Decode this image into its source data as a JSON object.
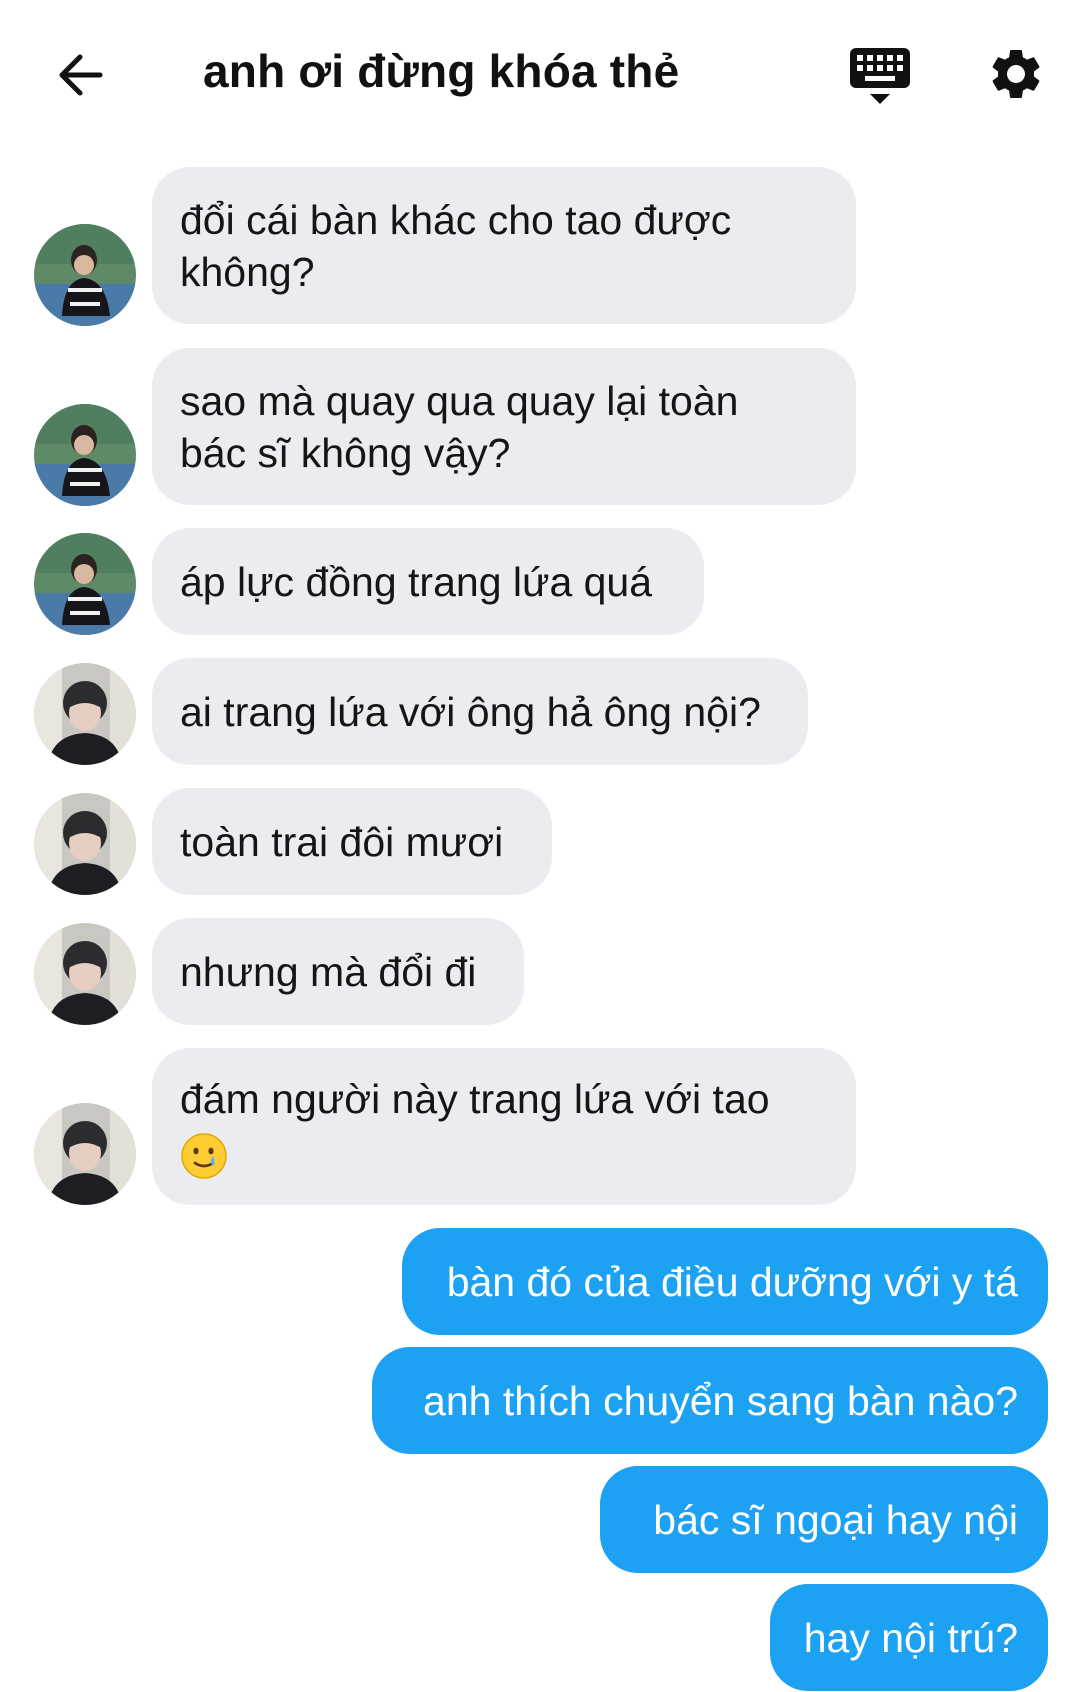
{
  "header": {
    "title": "anh ơi đừng khóa thẻ",
    "back_icon": "arrow-left-icon",
    "keyboard_icon": "keyboard-icon",
    "settings_icon": "gear-icon"
  },
  "colors": {
    "incoming_bubble": "#eaecef",
    "outgoing_bubble": "#1da1f2",
    "outgoing_text": "#ffffff"
  },
  "messages": [
    {
      "from": "other",
      "sender": "user-a",
      "lines": [
        "đổi cái bàn khác cho tao được",
        "không?"
      ]
    },
    {
      "from": "other",
      "sender": "user-a",
      "lines": [
        "sao mà quay qua quay lại toàn",
        "bác sĩ không vậy?"
      ]
    },
    {
      "from": "other",
      "sender": "user-a",
      "lines": [
        "áp lực đồng trang lứa quá"
      ]
    },
    {
      "from": "other",
      "sender": "user-b",
      "lines": [
        "ai trang lứa với ông hả ông nội?"
      ]
    },
    {
      "from": "other",
      "sender": "user-b",
      "lines": [
        "toàn trai đôi mươi"
      ]
    },
    {
      "from": "other",
      "sender": "user-b",
      "lines": [
        "nhưng mà đổi đi"
      ]
    },
    {
      "from": "other",
      "sender": "user-b",
      "lines": [
        "đám người này trang lứa với tao"
      ],
      "emoji": "smiling-face-with-tear"
    },
    {
      "from": "me",
      "lines": [
        "bàn đó của điều dưỡng với y tá"
      ]
    },
    {
      "from": "me",
      "lines": [
        "anh thích chuyển sang bàn nào?"
      ]
    },
    {
      "from": "me",
      "lines": [
        "bác sĩ ngoại hay nội"
      ]
    },
    {
      "from": "me",
      "lines": [
        "hay nội trú?"
      ]
    }
  ]
}
